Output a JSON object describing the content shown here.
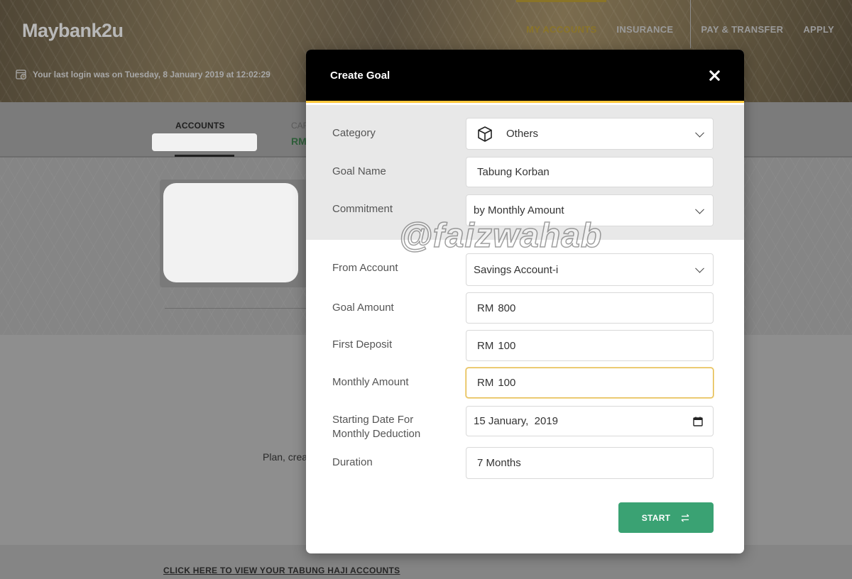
{
  "header": {
    "logo": "Maybank2u",
    "last_login": "Your last login was on Tuesday, 8 January 2019 at 12:02:29",
    "nav": [
      "MY ACCOUNTS",
      "INSURANCE",
      "PAY & TRANSFER",
      "APPLY"
    ],
    "nav_active": "MY ACCOUNTS"
  },
  "subnav": {
    "accounts_tab": "ACCOUNTS",
    "cards_tab": "CAR",
    "cards_value": "RM"
  },
  "page": {
    "plan_text": "Plan, crea",
    "tabung_link": "CLICK HERE TO VIEW YOUR TABUNG HAJI ACCOUNTS"
  },
  "modal": {
    "title": "Create Goal",
    "fields": {
      "category": {
        "label": "Category",
        "value": "Others"
      },
      "goal_name": {
        "label": "Goal Name",
        "value": "Tabung Korban"
      },
      "commitment": {
        "label": "Commitment",
        "value": "by Monthly Amount"
      },
      "from_account": {
        "label": "From Account",
        "value": "Savings Account-i"
      },
      "goal_amount": {
        "label": "Goal Amount",
        "prefix": "RM",
        "value": "800"
      },
      "first_deposit": {
        "label": "First Deposit",
        "prefix": "RM",
        "value": "100"
      },
      "monthly_amount": {
        "label": "Monthly Amount",
        "prefix": "RM",
        "value": "100"
      },
      "starting_date": {
        "label_line1": "Starting Date For",
        "label_line2": "Monthly Deduction",
        "value": "15 January,  2019"
      },
      "duration": {
        "label": "Duration",
        "value": "7 Months"
      }
    },
    "start_button": "START"
  },
  "watermark": "@faizwahab",
  "colors": {
    "accent_yellow": "#ffc83d",
    "start_green": "#3aa273",
    "modal_header": "#000000"
  }
}
